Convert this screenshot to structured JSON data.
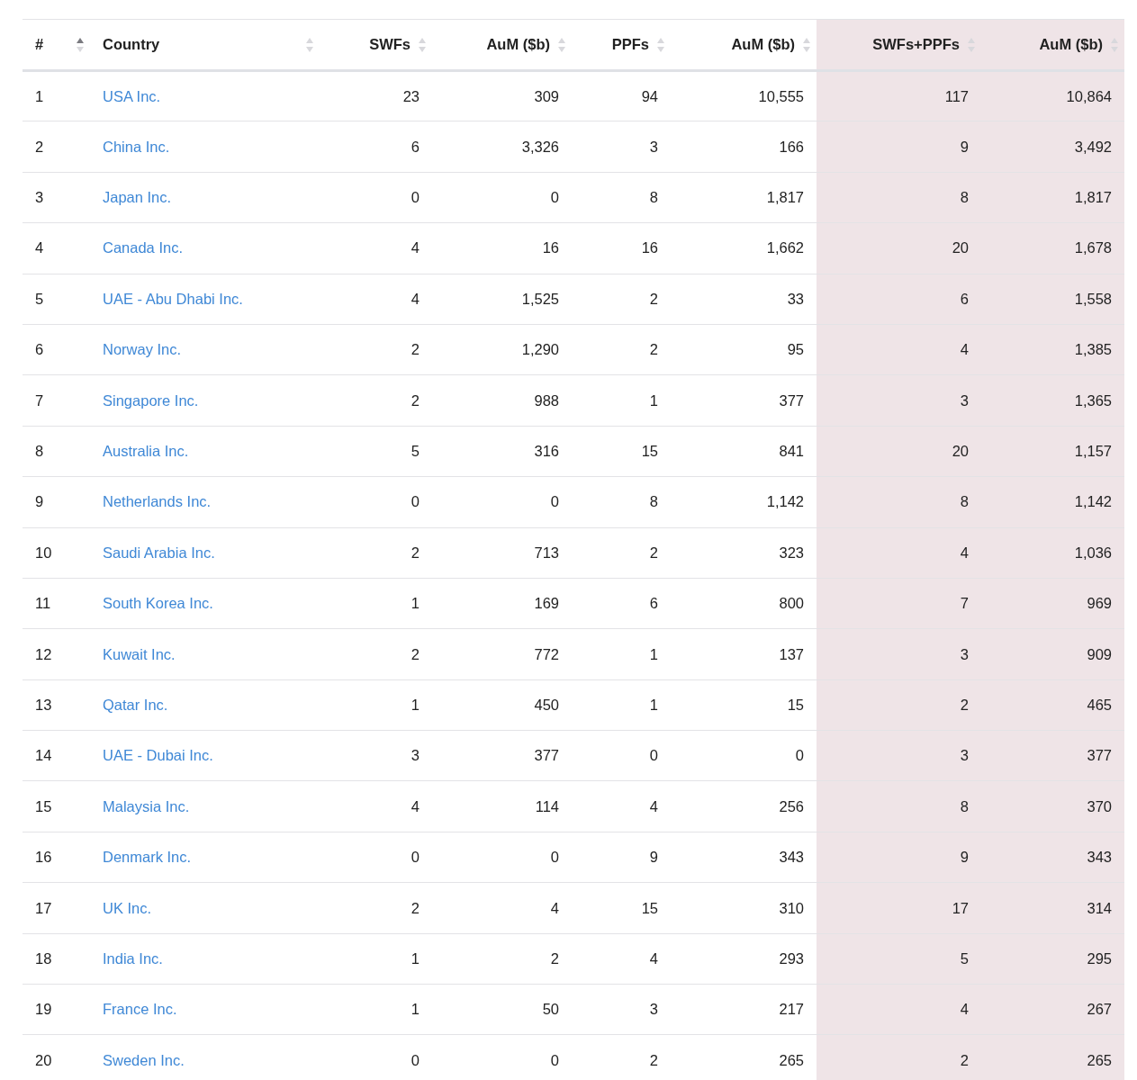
{
  "table": {
    "columns": [
      {
        "label": "#",
        "kind": "text",
        "sorted": true,
        "highlighted": false
      },
      {
        "label": "Country",
        "kind": "link",
        "sorted": false,
        "highlighted": false
      },
      {
        "label": "SWFs",
        "kind": "number",
        "sorted": false,
        "highlighted": false
      },
      {
        "label": "AuM ($b)",
        "kind": "number",
        "sorted": false,
        "highlighted": false
      },
      {
        "label": "PPFs",
        "kind": "number",
        "sorted": false,
        "highlighted": false
      },
      {
        "label": "AuM ($b)",
        "kind": "number",
        "sorted": false,
        "highlighted": false
      },
      {
        "label": "SWFs+PPFs",
        "kind": "number",
        "sorted": false,
        "highlighted": true
      },
      {
        "label": "AuM ($b)",
        "kind": "number",
        "sorted": false,
        "highlighted": true
      }
    ],
    "rows": [
      [
        "1",
        "USA Inc.",
        "23",
        "309",
        "94",
        "10,555",
        "117",
        "10,864"
      ],
      [
        "2",
        "China Inc.",
        "6",
        "3,326",
        "3",
        "166",
        "9",
        "3,492"
      ],
      [
        "3",
        "Japan Inc.",
        "0",
        "0",
        "8",
        "1,817",
        "8",
        "1,817"
      ],
      [
        "4",
        "Canada Inc.",
        "4",
        "16",
        "16",
        "1,662",
        "20",
        "1,678"
      ],
      [
        "5",
        "UAE - Abu Dhabi Inc.",
        "4",
        "1,525",
        "2",
        "33",
        "6",
        "1,558"
      ],
      [
        "6",
        "Norway Inc.",
        "2",
        "1,290",
        "2",
        "95",
        "4",
        "1,385"
      ],
      [
        "7",
        "Singapore Inc.",
        "2",
        "988",
        "1",
        "377",
        "3",
        "1,365"
      ],
      [
        "8",
        "Australia Inc.",
        "5",
        "316",
        "15",
        "841",
        "20",
        "1,157"
      ],
      [
        "9",
        "Netherlands Inc.",
        "0",
        "0",
        "8",
        "1,142",
        "8",
        "1,142"
      ],
      [
        "10",
        "Saudi Arabia Inc.",
        "2",
        "713",
        "2",
        "323",
        "4",
        "1,036"
      ],
      [
        "11",
        "South Korea Inc.",
        "1",
        "169",
        "6",
        "800",
        "7",
        "969"
      ],
      [
        "12",
        "Kuwait Inc.",
        "2",
        "772",
        "1",
        "137",
        "3",
        "909"
      ],
      [
        "13",
        "Qatar Inc.",
        "1",
        "450",
        "1",
        "15",
        "2",
        "465"
      ],
      [
        "14",
        "UAE - Dubai Inc.",
        "3",
        "377",
        "0",
        "0",
        "3",
        "377"
      ],
      [
        "15",
        "Malaysia Inc.",
        "4",
        "114",
        "4",
        "256",
        "8",
        "370"
      ],
      [
        "16",
        "Denmark Inc.",
        "0",
        "0",
        "9",
        "343",
        "9",
        "343"
      ],
      [
        "17",
        "UK Inc.",
        "2",
        "4",
        "15",
        "310",
        "17",
        "314"
      ],
      [
        "18",
        "India Inc.",
        "1",
        "2",
        "4",
        "293",
        "5",
        "295"
      ],
      [
        "19",
        "France Inc.",
        "1",
        "50",
        "3",
        "217",
        "4",
        "267"
      ],
      [
        "20",
        "Sweden Inc.",
        "0",
        "0",
        "2",
        "265",
        "2",
        "265"
      ]
    ]
  }
}
